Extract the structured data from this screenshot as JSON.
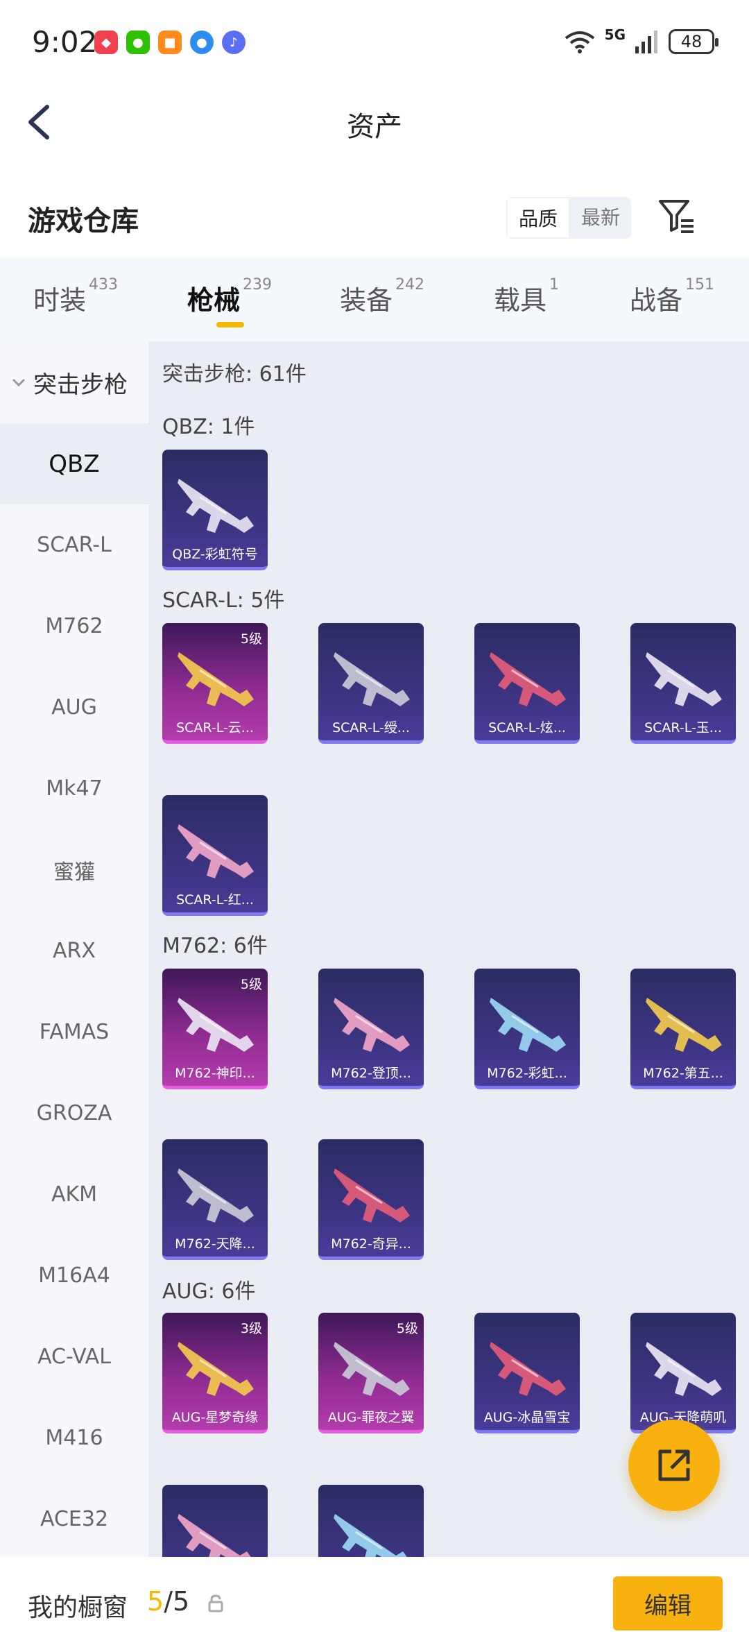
{
  "status_bar": {
    "time": "9:02",
    "signal_label": "5G",
    "battery": "48"
  },
  "header": {
    "title": "资产"
  },
  "warehouse": {
    "title": "游戏仓库",
    "sort_options": [
      "品质",
      "最新"
    ],
    "active_sort": "品质"
  },
  "tabs": [
    {
      "label": "时装",
      "count": "433"
    },
    {
      "label": "枪械",
      "count": "239"
    },
    {
      "label": "装备",
      "count": "242"
    },
    {
      "label": "载具",
      "count": "1"
    },
    {
      "label": "战备",
      "count": "151"
    }
  ],
  "active_tab": "枪械",
  "sidebar": {
    "category": "突击步枪",
    "items": [
      "QBZ",
      "SCAR-L",
      "M762",
      "AUG",
      "Mk47",
      "蜜獾",
      "ARX",
      "FAMAS",
      "GROZA",
      "AKM",
      "M16A4",
      "AC-VAL",
      "M416",
      "ACE32"
    ],
    "active": "QBZ"
  },
  "content": {
    "summary": "突击步枪: 61件",
    "groups": [
      {
        "label": "QBZ: 1件",
        "items": [
          {
            "name": "QBZ-彩虹符号",
            "level": "",
            "rarity": "purple"
          }
        ]
      },
      {
        "label": "SCAR-L: 5件",
        "items": [
          {
            "name": "SCAR-L-云...",
            "level": "5级",
            "rarity": "pink"
          },
          {
            "name": "SCAR-L-绶...",
            "level": "",
            "rarity": "purple"
          },
          {
            "name": "SCAR-L-炫...",
            "level": "",
            "rarity": "purple"
          },
          {
            "name": "SCAR-L-玉...",
            "level": "",
            "rarity": "purple"
          },
          {
            "name": "SCAR-L-红...",
            "level": "",
            "rarity": "purple"
          }
        ]
      },
      {
        "label": "M762: 6件",
        "items": [
          {
            "name": "M762-神印...",
            "level": "5级",
            "rarity": "pink"
          },
          {
            "name": "M762-登顶...",
            "level": "",
            "rarity": "purple"
          },
          {
            "name": "M762-彩虹...",
            "level": "",
            "rarity": "purple"
          },
          {
            "name": "M762-第五...",
            "level": "",
            "rarity": "purple"
          },
          {
            "name": "M762-天降...",
            "level": "",
            "rarity": "purple"
          },
          {
            "name": "M762-奇异...",
            "level": "",
            "rarity": "purple"
          }
        ]
      },
      {
        "label": "AUG: 6件",
        "items": [
          {
            "name": "AUG-星梦奇缘",
            "level": "3级",
            "rarity": "pink"
          },
          {
            "name": "AUG-罪夜之翼",
            "level": "5级",
            "rarity": "pink"
          },
          {
            "name": "AUG-冰晶雪宝",
            "level": "",
            "rarity": "purple"
          },
          {
            "name": "AUG-天降萌叽",
            "level": "",
            "rarity": "purple"
          },
          {
            "name": "",
            "level": "",
            "rarity": "purple"
          },
          {
            "name": "",
            "level": "",
            "rarity": "purple"
          }
        ]
      }
    ]
  },
  "bottom_bar": {
    "label": "我的橱窗",
    "count_current": "5",
    "count_total": "/5",
    "edit_label": "编辑"
  },
  "colors": {
    "accent": "#f9b10f",
    "purple_card": "#3f3586",
    "pink_card": "#8e2b90"
  }
}
